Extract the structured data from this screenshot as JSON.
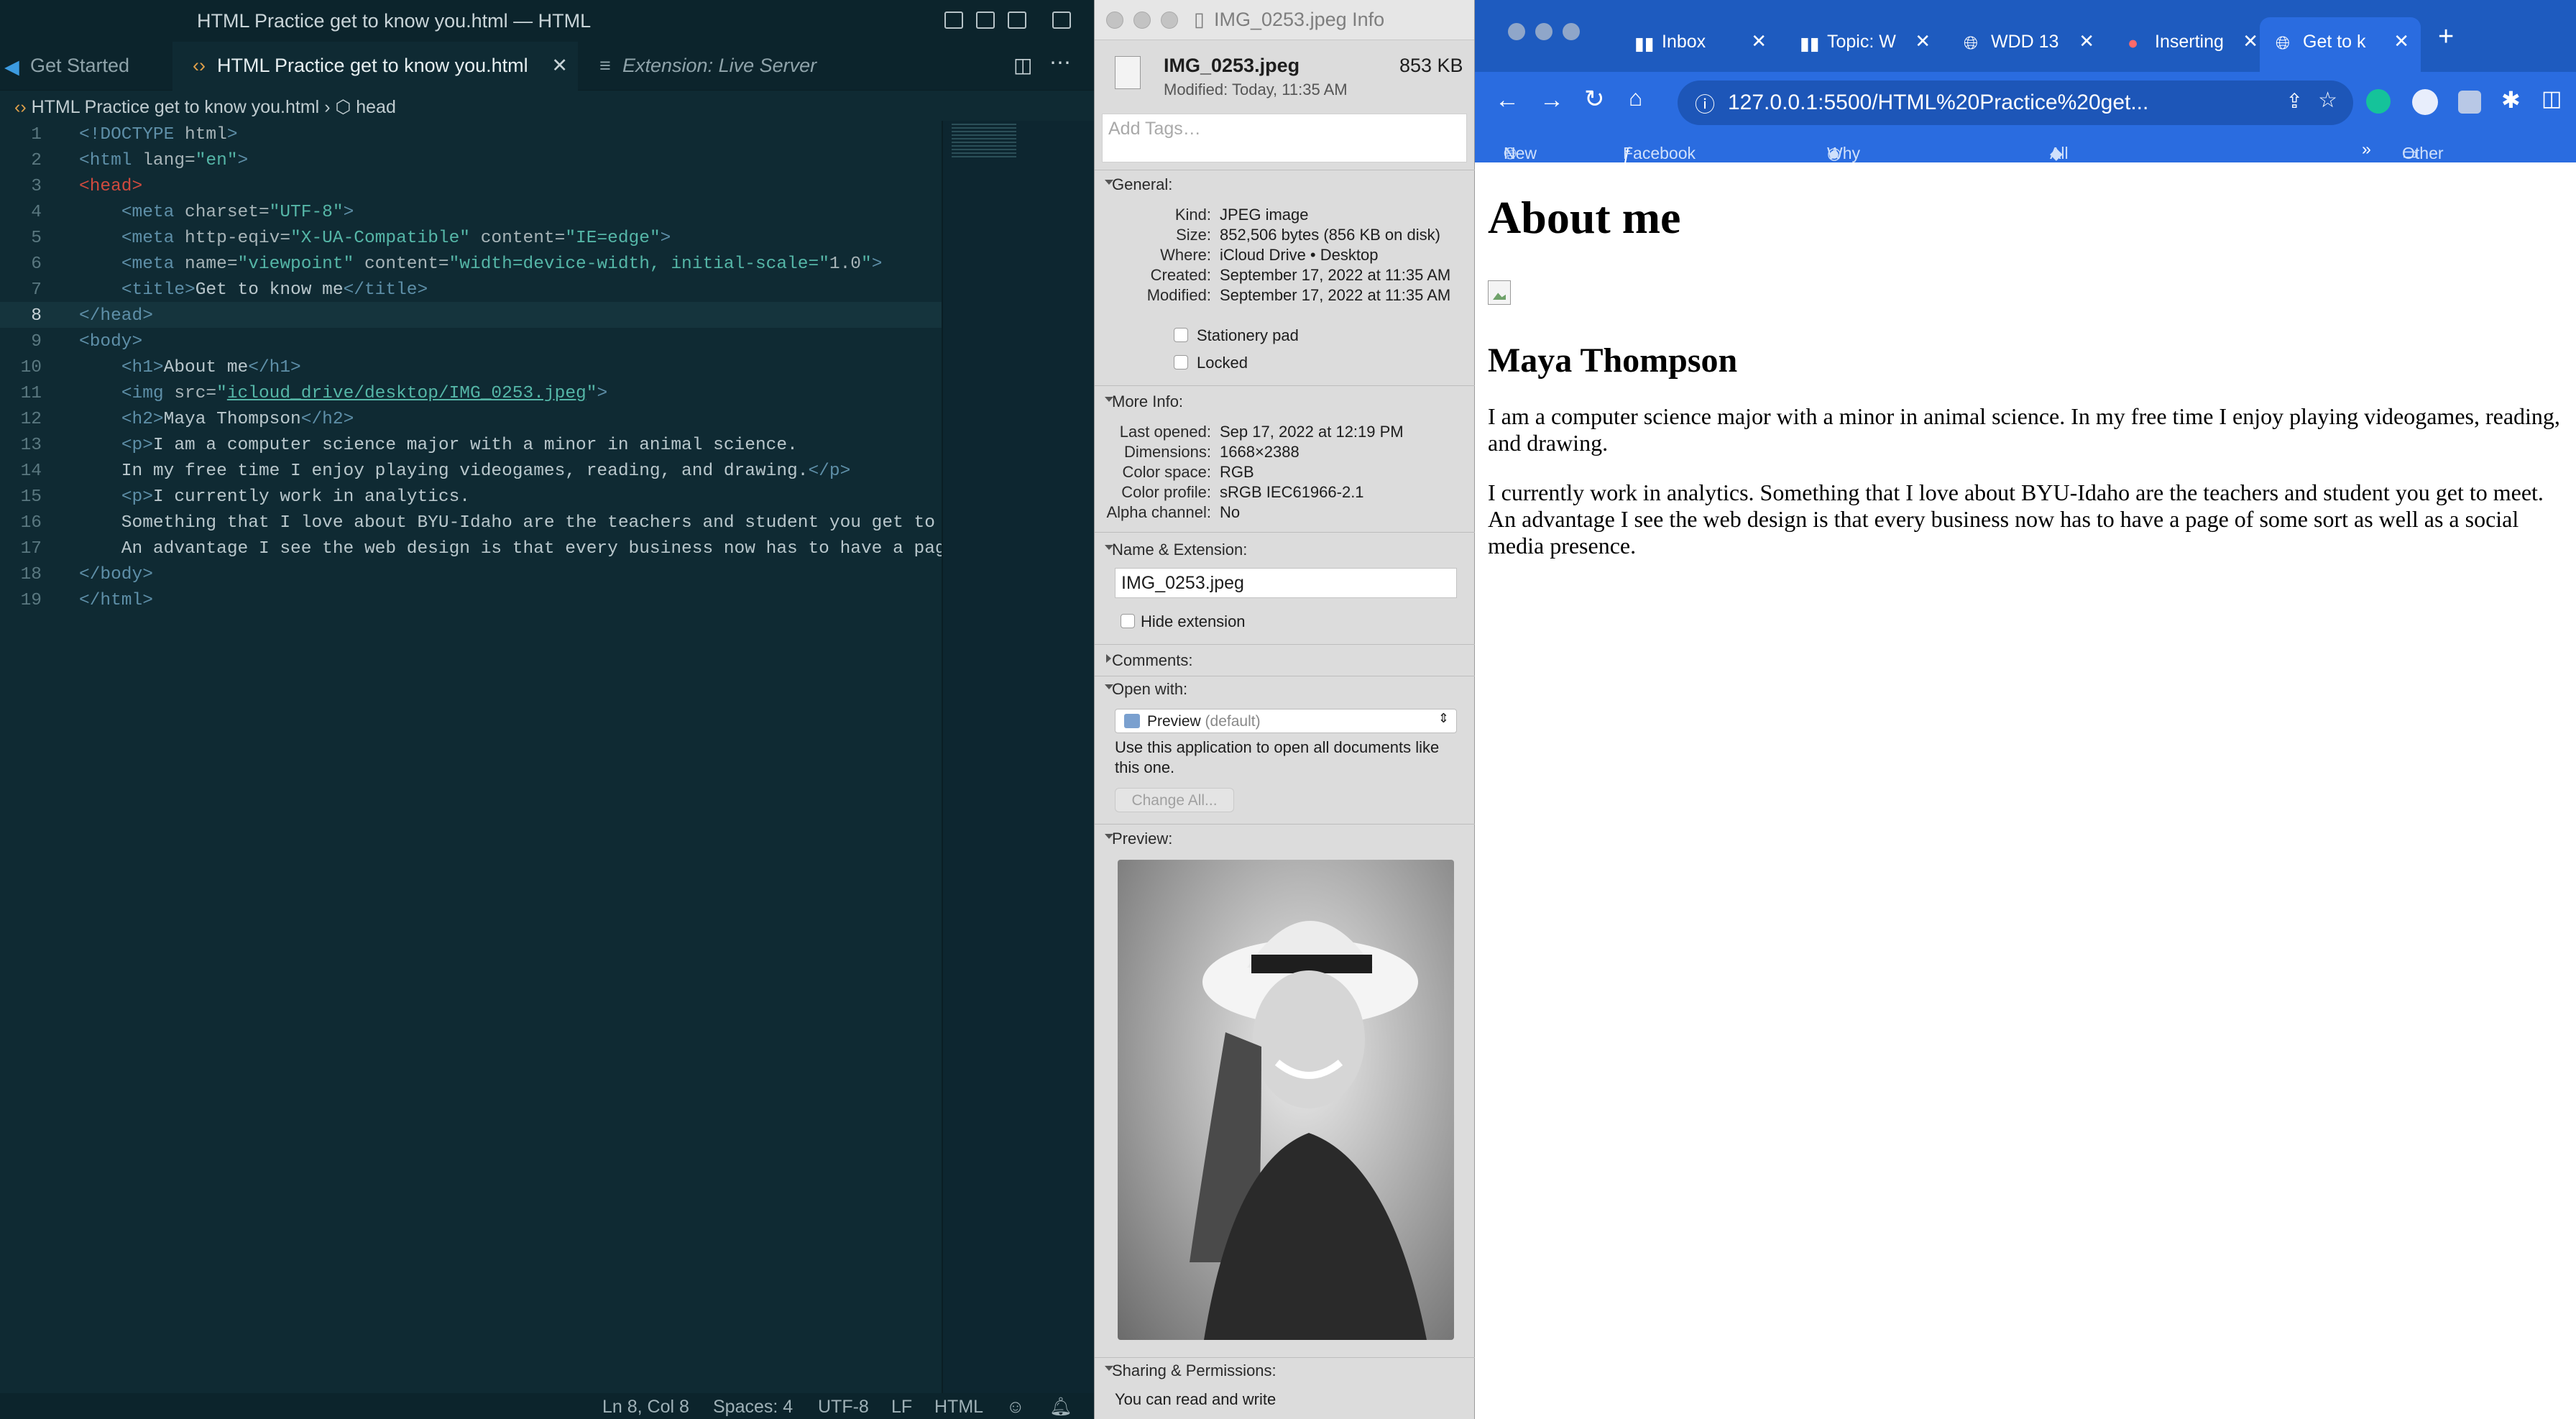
{
  "vscode": {
    "title": "HTML Practice get to know you.html — HTML",
    "tabs": [
      {
        "label": "Get Started"
      },
      {
        "label": "HTML Practice get to know you.html"
      },
      {
        "label": "Extension: Live Server"
      }
    ],
    "breadcrumb": {
      "file": "HTML Practice get to know you.html",
      "symbol": "head"
    },
    "line_numbers": [
      "1",
      "2",
      "3",
      "4",
      "5",
      "6",
      "7",
      "8",
      "9",
      "10",
      "11",
      "12",
      "13",
      "14",
      "15",
      "16",
      "17",
      "18",
      "19"
    ],
    "status": {
      "position": "Ln 8, Col 8",
      "spaces": "Spaces: 4",
      "encoding": "UTF-8",
      "eol": "LF",
      "language": "HTML"
    }
  },
  "finder": {
    "title": "IMG_0253.jpeg Info",
    "file_name": "IMG_0253.jpeg",
    "file_size": "853 KB",
    "modified_short": "Modified: Today, 11:35 AM",
    "tags_placeholder": "Add Tags…",
    "general": {
      "heading": "General:",
      "rows": [
        {
          "label": "Kind:",
          "value": "JPEG image"
        },
        {
          "label": "Size:",
          "value": "852,506 bytes (856 KB on disk)"
        },
        {
          "label": "Where:",
          "value": "iCloud Drive • Desktop"
        },
        {
          "label": "Created:",
          "value": "September 17, 2022 at 11:35 AM"
        },
        {
          "label": "Modified:",
          "value": "September 17, 2022 at 11:35 AM"
        }
      ],
      "stationery": "Stationery pad",
      "locked": "Locked"
    },
    "more_info": {
      "heading": "More Info:",
      "rows": [
        {
          "label": "Last opened:",
          "value": "Sep 17, 2022 at 12:19 PM"
        },
        {
          "label": "Dimensions:",
          "value": "1668×2388"
        },
        {
          "label": "Color space:",
          "value": "RGB"
        },
        {
          "label": "Color profile:",
          "value": "sRGB IEC61966-2.1"
        },
        {
          "label": "Alpha channel:",
          "value": "No"
        }
      ]
    },
    "name_ext": {
      "heading": "Name & Extension:",
      "value": "IMG_0253.jpeg",
      "hide": "Hide extension"
    },
    "comments": "Comments:",
    "open_with": {
      "heading": "Open with:",
      "app": "Preview",
      "app_suffix": "(default)",
      "note": "Use this application to open all documents like this one.",
      "button": "Change All..."
    },
    "preview": "Preview:",
    "sharing": {
      "heading": "Sharing & Permissions:",
      "note": "You can read and write"
    }
  },
  "chrome": {
    "tabs": [
      {
        "label": "Inbox"
      },
      {
        "label": "Topic: W"
      },
      {
        "label": "WDD 13"
      },
      {
        "label": "Inserting"
      },
      {
        "label": "Get to k"
      }
    ],
    "url": "127.0.0.1:5500/HTML%20Practice%20get...",
    "bookmarks": [
      "New Tab",
      "Facebook | Baby...",
      "Why Are Cells Imp...",
      "All living things ar...",
      "»",
      "Other Bookmarks"
    ],
    "page": {
      "h1": "About me",
      "h2": "Maya Thompson",
      "p1": "I am a computer science major with a minor in animal science. In my free time I enjoy playing videogames, reading, and drawing.",
      "p2": "I currently work in analytics. Something that I love about BYU-Idaho are the teachers and student you get to meet. An advantage I see the web design is that every business now has to have a page of some sort as well as a social media presence."
    }
  },
  "colors": {
    "vscode_bg": "#0f2a33",
    "chrome_blue": "#2a6ce0",
    "finder_bg": "#dcdcdc"
  }
}
